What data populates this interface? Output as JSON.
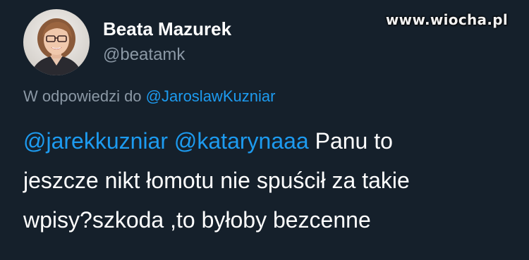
{
  "watermark": "www.wiocha.pl",
  "author": {
    "name": "Beata Mazurek",
    "handle": "@beatamk"
  },
  "reply": {
    "prefix": "W odpowiedzi do",
    "mention": "@JaroslawKuzniar"
  },
  "tweet": {
    "mention1": "@jarekkuzniar",
    "mention2": "@katarynaaa",
    "line1_rest": "Panu to",
    "line2": "jeszcze nikt łomotu nie spuścił za takie",
    "line3": "wpisy?szkoda ,to byłoby bezcenne"
  },
  "colors": {
    "background": "#15202b",
    "mention": "#1d9bf0",
    "secondary_text": "#8b98a5"
  }
}
